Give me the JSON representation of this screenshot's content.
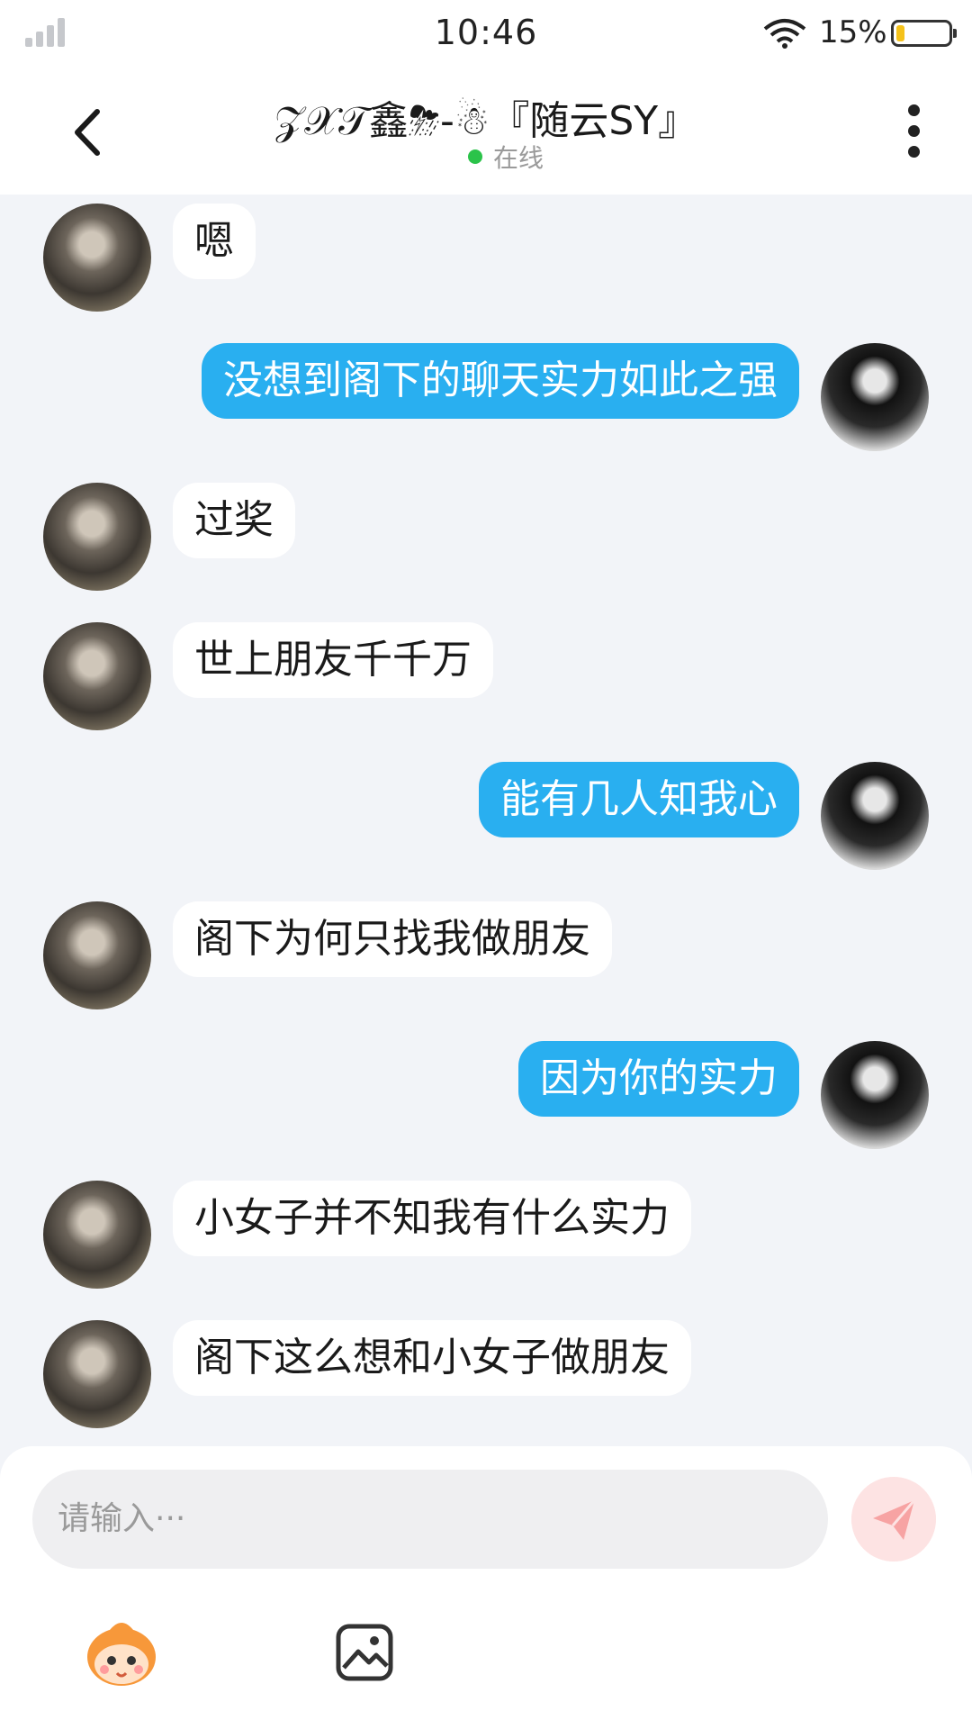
{
  "status_bar": {
    "time": "10:46",
    "battery_pct": "15%",
    "battery_level": 0.15,
    "icons": [
      "signal-icon",
      "wifi-icon",
      "battery-icon"
    ]
  },
  "header": {
    "title": "𝒵𝒳𝒯鑫⛈-☃『随云SY』",
    "status": "在线",
    "back_icon": "chevron-left-icon",
    "more_icon": "more-vertical-icon"
  },
  "messages": [
    {
      "side": "left",
      "text": "嗯"
    },
    {
      "side": "right",
      "text": "没想到阁下的聊天实力如此之强"
    },
    {
      "side": "left",
      "text": "过奖"
    },
    {
      "side": "left",
      "text": "世上朋友千千万"
    },
    {
      "side": "right",
      "text": "能有几人知我心"
    },
    {
      "side": "left",
      "text": "阁下为何只找我做朋友"
    },
    {
      "side": "right",
      "text": "因为你的实力"
    },
    {
      "side": "left",
      "text": "小女子并不知我有什么实力"
    },
    {
      "side": "left",
      "text": "阁下这么想和小女子做朋友"
    }
  ],
  "input": {
    "placeholder": "请输入···",
    "send_icon": "send-icon",
    "toolbar_icons": [
      "mascot-emoji-icon",
      "image-icon"
    ]
  },
  "colors": {
    "accent": "#29aff0",
    "background": "#f2f4f8",
    "online": "#2bc34a",
    "send_disabled": "#fde3e3",
    "battery": "#f5c21a"
  }
}
